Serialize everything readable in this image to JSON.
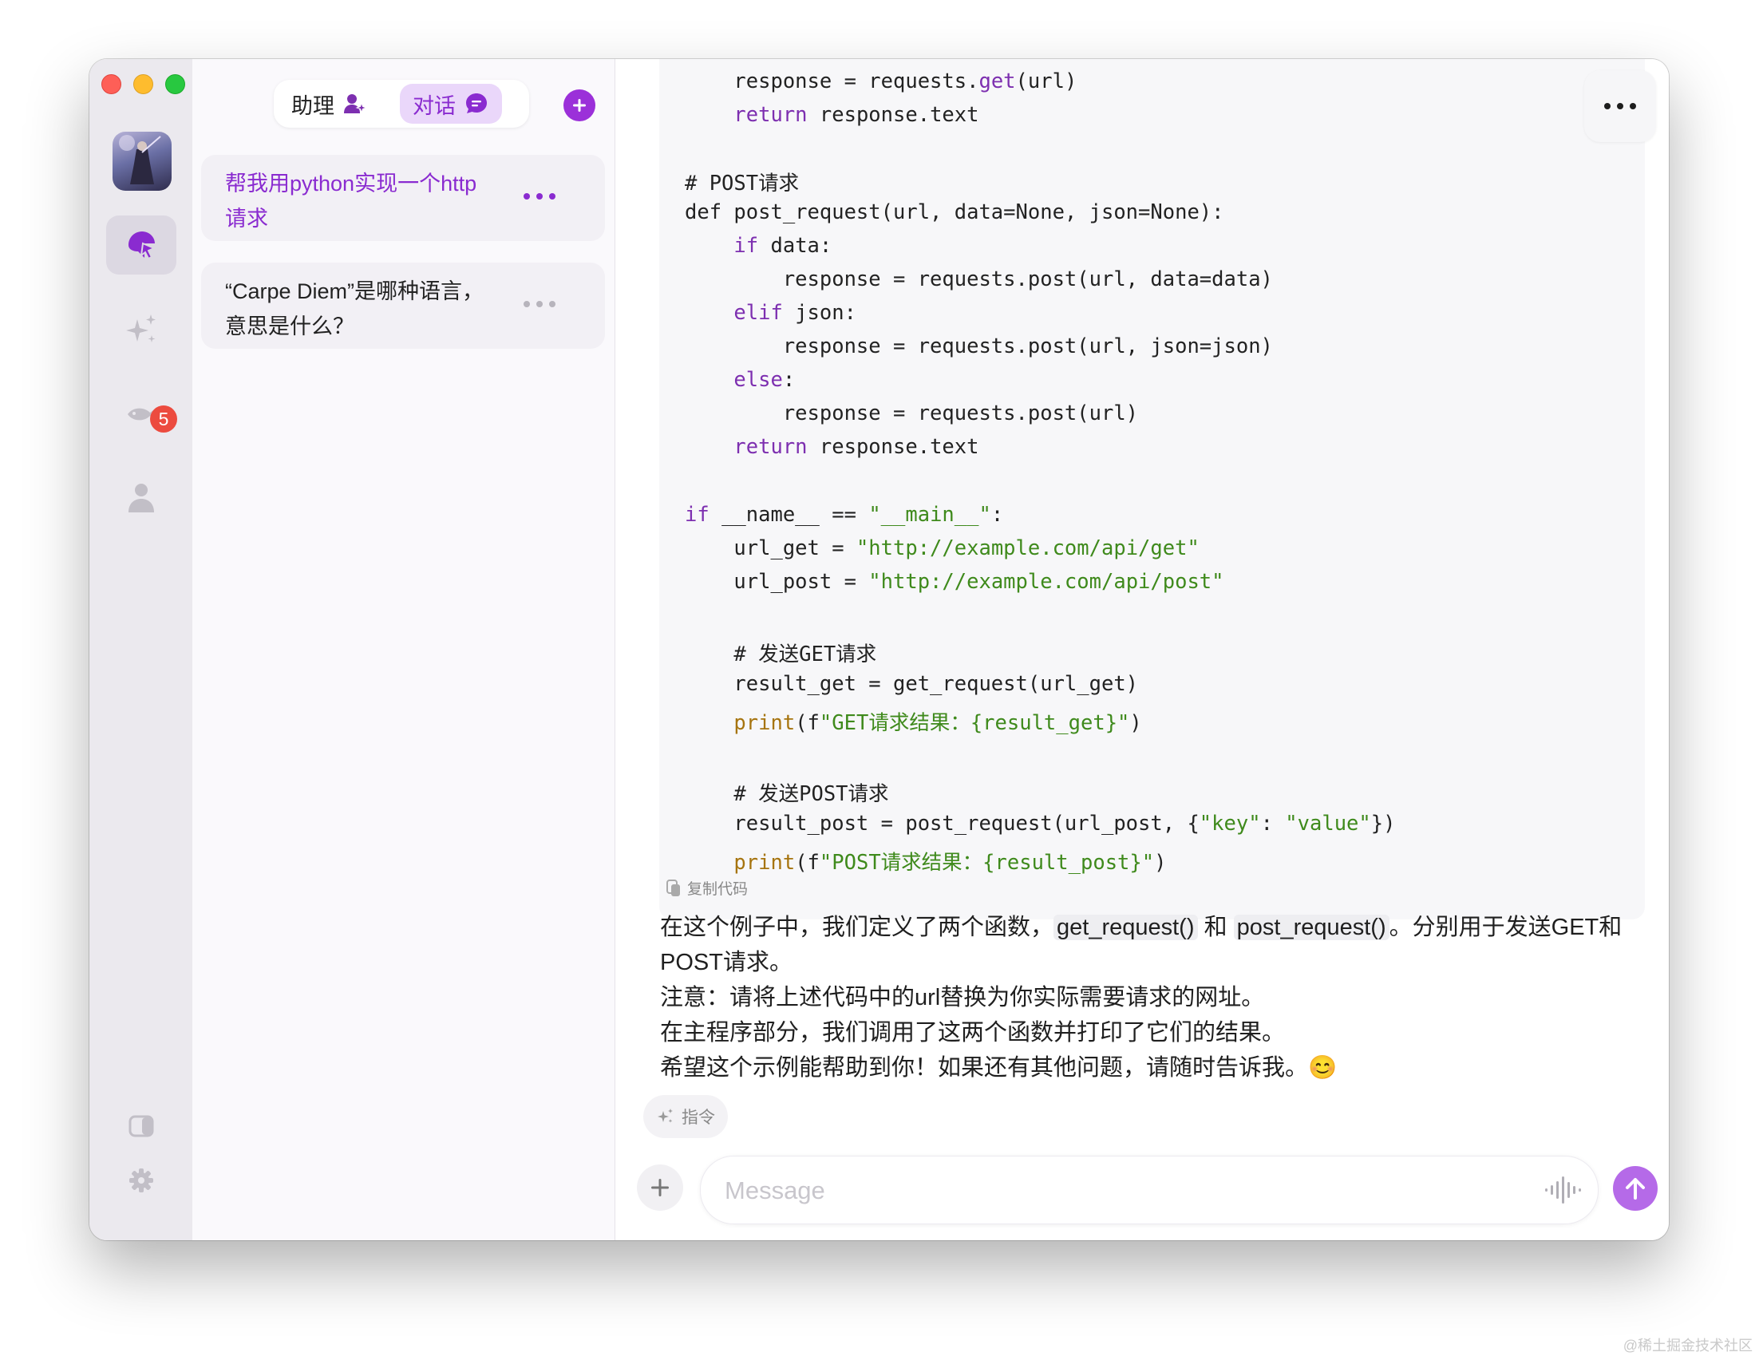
{
  "sidebar": {
    "badge_count": "5"
  },
  "list": {
    "tab_assistant": "助理",
    "tab_chat": "对话",
    "conversations": [
      {
        "title": "帮我用python实现一个http请求"
      },
      {
        "title": "“Carpe Diem”是哪种语言，意思是什么？"
      }
    ]
  },
  "code": {
    "lines": [
      "    response = requests.get(url)",
      "    return response.text",
      "",
      "# POST请求",
      "def post_request(url, data=None, json=None):",
      "    if data:",
      "        response = requests.post(url, data=data)",
      "    elif json:",
      "        response = requests.post(url, json=json)",
      "    else:",
      "        response = requests.post(url)",
      "    return response.text",
      "",
      "if __name__ == \"__main__\":",
      "    url_get = \"http://example.com/api/get\"",
      "    url_post = \"http://example.com/api/post\"",
      "",
      "    # 发送GET请求",
      "    result_get = get_request(url_get)",
      "    print(f\"GET请求结果：{result_get}\")",
      "",
      "    # 发送POST请求",
      "    result_post = post_request(url_post, {\"key\": \"value\"})",
      "    print(f\"POST请求结果：{result_post}\")"
    ],
    "copy_label": "复制代码"
  },
  "answer": {
    "p1_a": "在这个例子中，我们定义了两个函数，",
    "code1": "get_request()",
    "p1_b": " 和 ",
    "code2": "post_request()",
    "p1_c": "。分别用于发送GET和POST请求。",
    "p2": "注意：请将上述代码中的url替换为你实际需要请求的网址。",
    "p3": "在主程序部分，我们调用了这两个函数并打印了它们的结果。",
    "p4": "希望这个示例能帮助到你！如果还有其他问题，请随时告诉我。😊"
  },
  "composer": {
    "instruction_label": "指令",
    "placeholder": "Message"
  },
  "watermark": "@稀土掘金技术社区",
  "colors": {
    "accent": "#9b30d9",
    "accent_light": "#ead7fa",
    "send_button": "#b56ae8",
    "badge": "#ec4b3f"
  }
}
